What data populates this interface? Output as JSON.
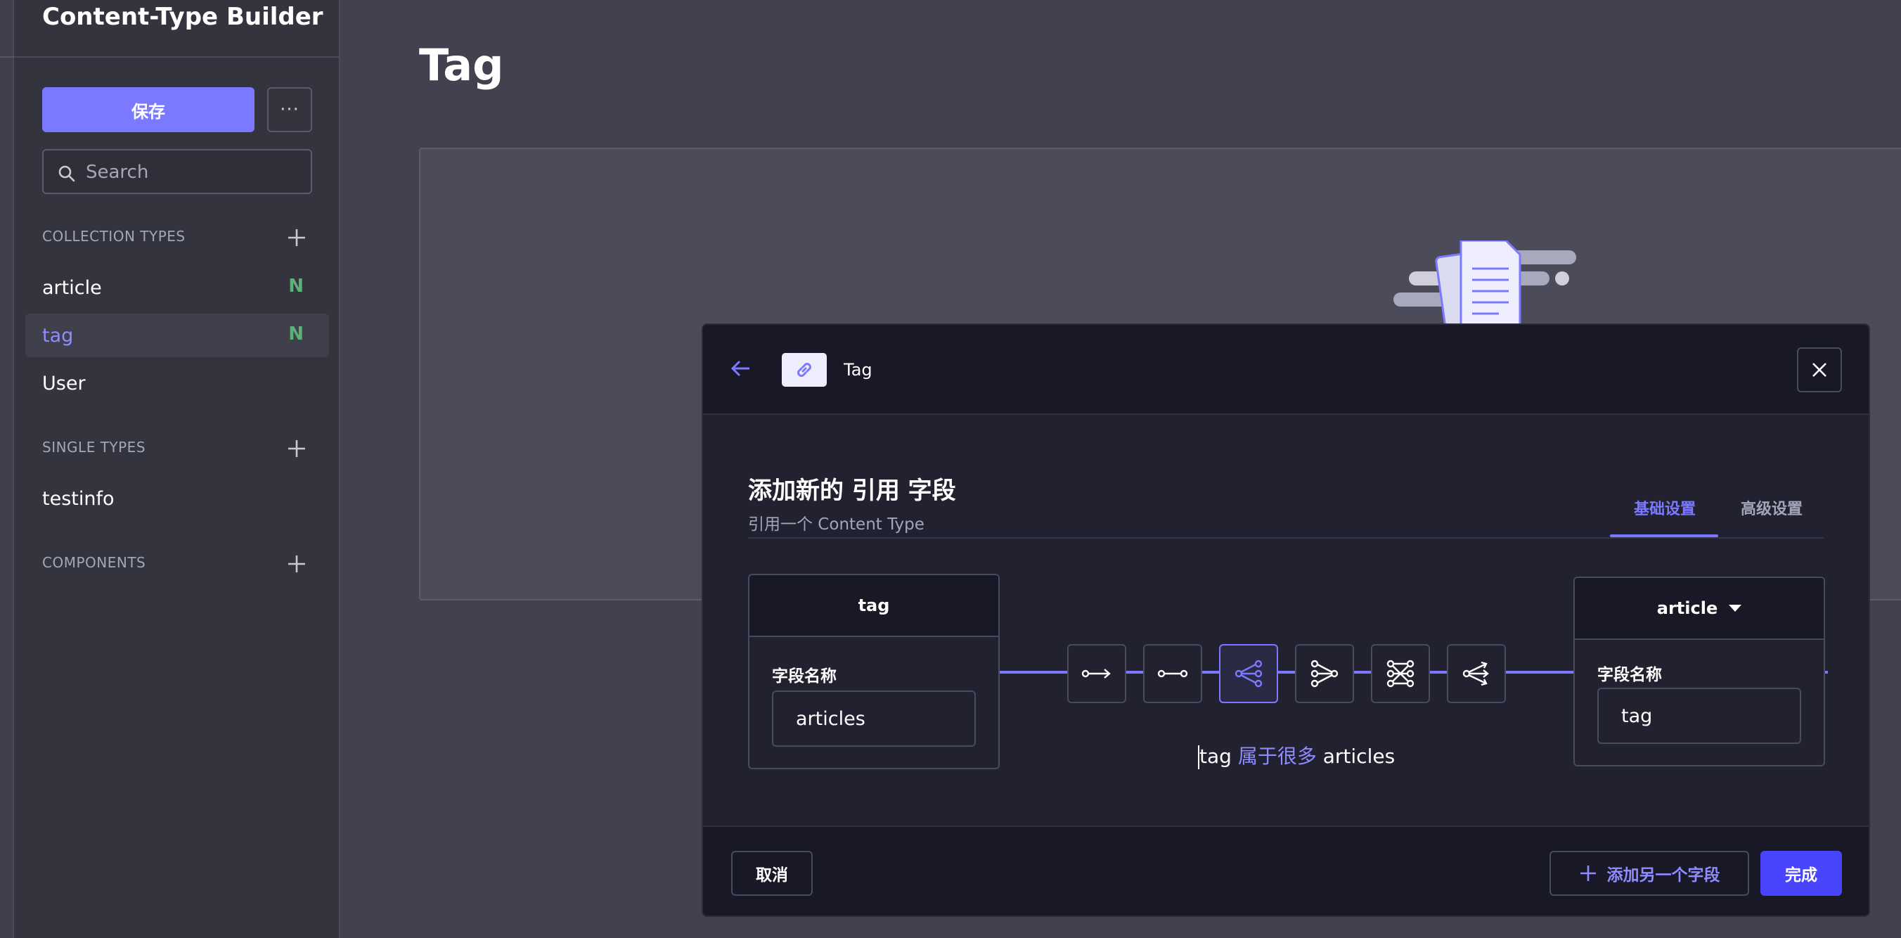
{
  "sidebar": {
    "title": "Content-Type Builder",
    "save_label": "保存",
    "more_label": "···",
    "search": {
      "placeholder": "Search",
      "value": ""
    },
    "collection_types": {
      "heading": "COLLECTION TYPES",
      "items": [
        {
          "label": "article",
          "badge": "N",
          "active": false
        },
        {
          "label": "tag",
          "badge": "N",
          "active": true
        },
        {
          "label": "User",
          "badge": "",
          "active": false
        }
      ]
    },
    "single_types": {
      "heading": "SINGLE TYPES",
      "items": [
        {
          "label": "testinfo"
        }
      ]
    },
    "components": {
      "heading": "COMPONENTS"
    }
  },
  "main": {
    "page_title": "Tag"
  },
  "modal": {
    "breadcrumb": "Tag",
    "title": "添加新的 引用 字段",
    "subtitle": "引用一个 Content Type",
    "tabs": [
      {
        "label": "基础设置",
        "active": true
      },
      {
        "label": "高级设置",
        "active": false
      }
    ],
    "left_box": {
      "content_type": "tag",
      "field_label": "字段名称",
      "field_value": "articles"
    },
    "right_box": {
      "content_type": "article",
      "field_label": "字段名称",
      "field_value": "tag"
    },
    "relation_types": [
      {
        "icon": "one-way-relation-icon",
        "active": false
      },
      {
        "icon": "one-to-one-relation-icon",
        "active": false
      },
      {
        "icon": "one-to-many-relation-icon",
        "active": true
      },
      {
        "icon": "many-to-one-relation-icon",
        "active": false
      },
      {
        "icon": "many-to-many-relation-icon",
        "active": false
      },
      {
        "icon": "many-way-relation-icon",
        "active": false
      }
    ],
    "sentence": {
      "subject": "tag",
      "verb": "属于很多",
      "object": "articles"
    },
    "footer": {
      "cancel_label": "取消",
      "add_another_label": "添加另一个字段",
      "done_label": "完成"
    }
  },
  "colors": {
    "accent": "#7b79ff",
    "primary_button": "#4945ff",
    "new_badge": "#5cb176"
  }
}
